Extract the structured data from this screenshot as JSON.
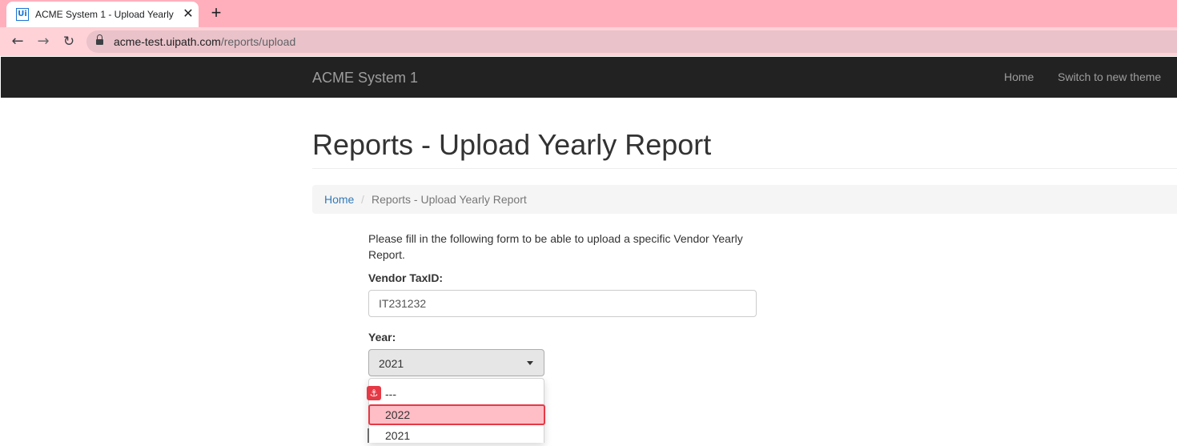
{
  "browser": {
    "tab_title": "ACME System 1 - Upload Yearly Report",
    "favicon_text": "Ui",
    "close_glyph": "✕",
    "new_tab_glyph": "+",
    "back_glyph": "←",
    "forward_glyph": "→",
    "reload_glyph": "↻",
    "url_host": "acme-test.uipath.com",
    "url_path": "/reports/upload"
  },
  "navbar": {
    "brand": "ACME System 1",
    "links": [
      "Home",
      "Switch to new theme"
    ]
  },
  "page": {
    "title": "Reports - Upload Yearly Report",
    "breadcrumb": {
      "home": "Home",
      "separator": "/",
      "current": "Reports - Upload Yearly Report"
    },
    "intro": "Please fill in the following form to be able to upload a specific Vendor Yearly Report."
  },
  "form": {
    "taxid_label": "Vendor TaxID:",
    "taxid_value": "IT231232",
    "year_label": "Year:",
    "year_value": "2021",
    "year_options": [
      "---",
      "2022",
      "2021"
    ],
    "highlighted_option": "2022"
  },
  "overlay": {
    "anchor_icon": "anchor-icon",
    "anchor_glyph": "⚓"
  },
  "colors": {
    "tabstrip": "#ffafbc",
    "toolbar": "#ffd2d8",
    "navbar": "#222222",
    "link": "#337ab7",
    "highlight": "#e53945"
  }
}
